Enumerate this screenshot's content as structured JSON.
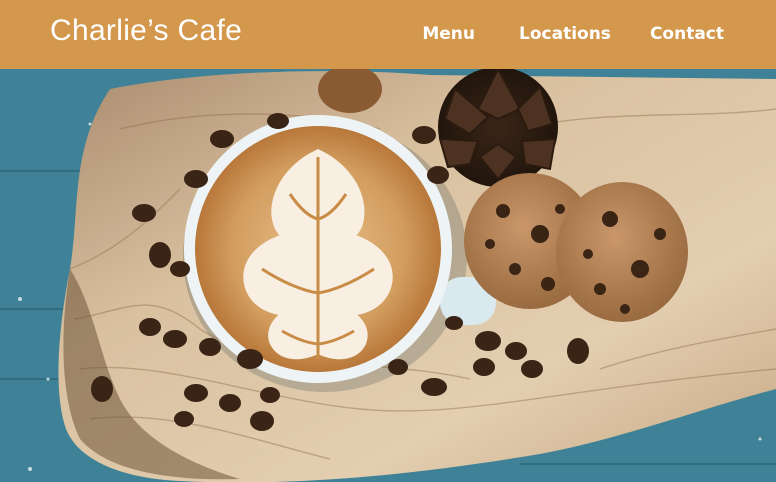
{
  "header": {
    "brand": "Charlie’s Cafe",
    "nav": [
      {
        "label": "Menu"
      },
      {
        "label": "Locations"
      },
      {
        "label": "Contact"
      }
    ]
  },
  "colors": {
    "header_bg": "#d4984c",
    "table_blue": "#3e7f93",
    "board_wood": "#d8bf9c",
    "latte_foam": "#f7eee0",
    "latte_crema": "#c98c46",
    "cookie": "#b88658"
  },
  "hero": {
    "image": "coffee-latte-cookies-photo"
  }
}
